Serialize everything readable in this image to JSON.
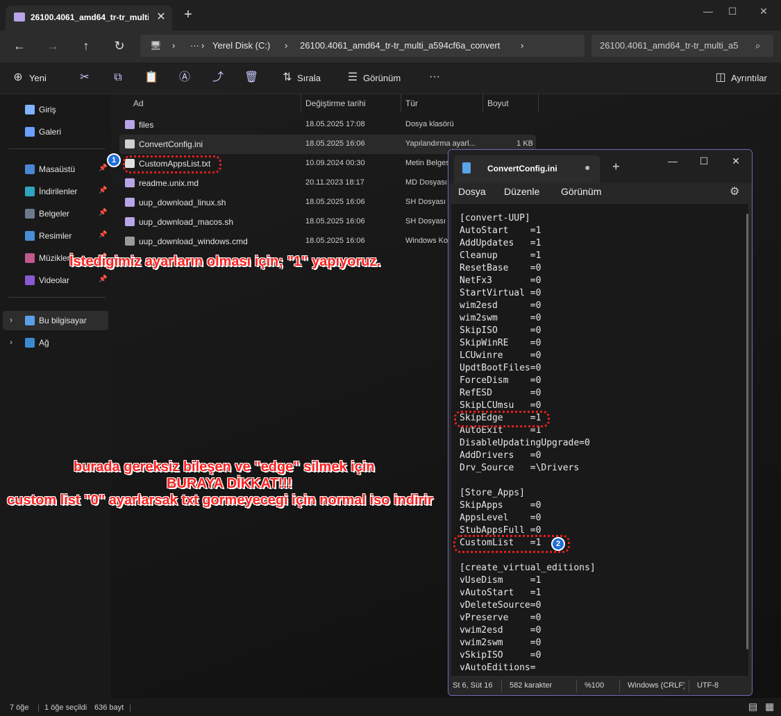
{
  "explorer": {
    "tab_title": "26100.4061_amd64_tr-tr_multi_",
    "tab_close": "✕",
    "new_tab": "+",
    "window_controls": {
      "minimize": "—",
      "maximize": "☐",
      "close": "✕"
    },
    "nav": {
      "back": "←",
      "forward": "→",
      "up": "↑",
      "refresh": "↻"
    },
    "breadcrumb": {
      "sep": "›",
      "more": "···",
      "items": [
        "Yerel Disk (C:)",
        "26100.4061_amd64_tr-tr_multi_a594cf6a_convert"
      ]
    },
    "search_placeholder": "26100.4061_amd64_tr-tr_multi_a5",
    "toolbar": {
      "new_label": "Yeni",
      "sort_label": "Sırala",
      "view_label": "Görünüm",
      "more": "···",
      "details_label": "Ayrıntılar"
    },
    "sidebar": {
      "quick": [
        {
          "label": "Giriş",
          "color": "#7fb3ff"
        },
        {
          "label": "Galeri",
          "color": "#6aa0ff"
        }
      ],
      "pinned": [
        {
          "label": "Masaüstü",
          "color": "#4a86d6"
        },
        {
          "label": "İndirilenler",
          "color": "#2fa5c0"
        },
        {
          "label": "Belgeler",
          "color": "#6b7a8f"
        },
        {
          "label": "Resimler",
          "color": "#4a8fd6"
        },
        {
          "label": "Müzikler",
          "color": "#c05a8a"
        },
        {
          "label": "Videolar",
          "color": "#8a5ad0"
        }
      ],
      "pin_glyph": "📌",
      "tree": [
        {
          "label": "Bu bilgisayar",
          "color": "#5aa0e8"
        },
        {
          "label": "Ağ",
          "color": "#3a8ad0"
        }
      ]
    },
    "columns": [
      "Ad",
      "Değiştirme tarihi",
      "Tür",
      "Boyut"
    ],
    "files": [
      {
        "name": "files",
        "date": "18.05.2025 17:08",
        "type": "Dosya klasörü",
        "size": "",
        "icon": "folder-icon",
        "color": "#b8a4e6"
      },
      {
        "name": "ConvertConfig.ini",
        "date": "18.05.2025 16:06",
        "type": "Yapılandırma ayarl...",
        "size": "1 KB",
        "icon": "ini-file-icon",
        "color": "#cfcfcf"
      },
      {
        "name": "CustomAppsList.txt",
        "date": "10.09.2024 00:30",
        "type": "Metin Belgesi",
        "size": "",
        "icon": "text-file-icon",
        "color": "#e0e0e0"
      },
      {
        "name": "readme.unix.md",
        "date": "20.11.2023 18:17",
        "type": "MD Dosyası",
        "size": "",
        "icon": "md-file-icon",
        "color": "#b8a4e6"
      },
      {
        "name": "uup_download_linux.sh",
        "date": "18.05.2025 16:06",
        "type": "SH Dosyası",
        "size": "",
        "icon": "sh-file-icon",
        "color": "#b8a4e6"
      },
      {
        "name": "uup_download_macos.sh",
        "date": "18.05.2025 16:06",
        "type": "SH Dosyası",
        "size": "",
        "icon": "sh-file-icon",
        "color": "#b8a4e6"
      },
      {
        "name": "uup_download_windows.cmd",
        "date": "18.05.2025 16:06",
        "type": "Windows Ko",
        "size": "",
        "icon": "cmd-file-icon",
        "color": "#9a9a9a"
      }
    ],
    "status": {
      "count": "7 öğe",
      "selected": "1 öğe seçildi",
      "size": "636 bayt"
    }
  },
  "notepad": {
    "title": "ConvertConfig.ini",
    "unsaved_dot": "●",
    "new_tab": "+",
    "window_controls": {
      "minimize": "—",
      "maximize": "☐",
      "close": "✕"
    },
    "menu": [
      "Dosya",
      "Düzenle",
      "Görünüm"
    ],
    "gear": "⚙",
    "content": "[convert-UUP]\nAutoStart    =1\nAddUpdates   =1\nCleanup      =1\nResetBase    =0\nNetFx3       =0\nStartVirtual =0\nwim2esd      =0\nwim2swm      =0\nSkipISO      =0\nSkipWinRE    =0\nLCUwinre     =0\nUpdtBootFiles=0\nForceDism    =0\nRefESD       =0\nSkipLCUmsu   =0\nSkipEdge     =1\nAutoExit     =1\nDisableUpdatingUpgrade=0\nAddDrivers   =0\nDrv_Source   =\\Drivers\n\n[Store_Apps]\nSkipApps     =0\nAppsLevel    =0\nStubAppsFull =0\nCustomList   =1\n\n[create_virtual_editions]\nvUseDism     =1\nvAutoStart   =1\nvDeleteSource=0\nvPreserve    =0\nvwim2esd     =0\nvwim2swm     =0\nvSkipISO     =0\nvAutoEditions=",
    "status": {
      "position": "St 6, Süt 16",
      "chars": "582 karakter",
      "zoom": "%100",
      "eol": "Windows (CRLF)",
      "encoding": "UTF-8"
    }
  },
  "annotations": {
    "line1": "İstedigimiz ayarların olması için; \"1\" yapıyoruz.",
    "line2": "burada gereksiz bileşen ve \"edge\" silmek için",
    "line3": "BURAYA DİKKAT!!!",
    "line4": "custom list \"0\" ayarlarsak txt gormeyecegi için normal iso indirir",
    "badge1": "1",
    "badge2": "2",
    "accent": "#ff2020"
  }
}
